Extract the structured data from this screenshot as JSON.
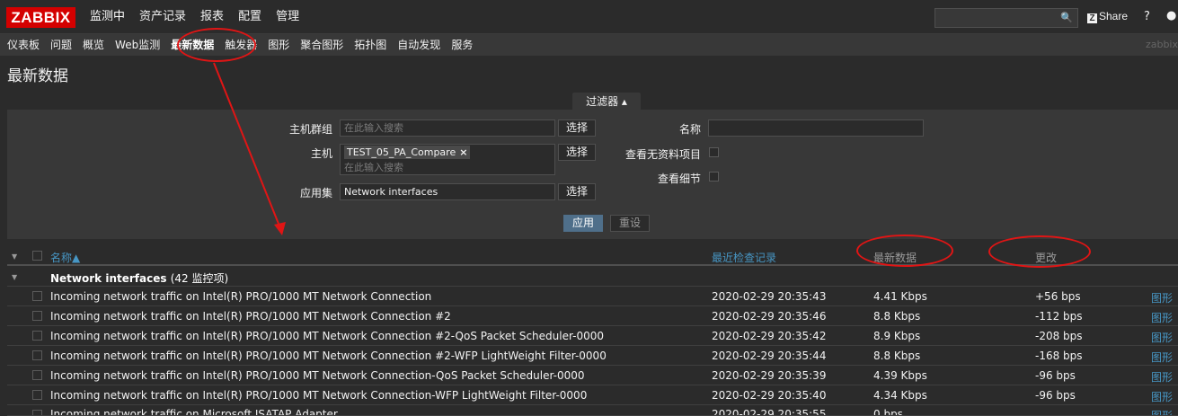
{
  "logo": "ZABBIX",
  "main_menu": [
    "监测中",
    "资产记录",
    "报表",
    "配置",
    "管理"
  ],
  "share": "Share",
  "share_badge": "Z",
  "help": "?",
  "sub_menu": [
    "仪表板",
    "问题",
    "概览",
    "Web监测",
    "最新数据",
    "触发器",
    "图形",
    "聚合图形",
    "拓扑图",
    "自动发现",
    "服务"
  ],
  "server_name": "zabbix",
  "page_title": "最新数据",
  "filter": {
    "tab_label": "过滤器 ▴",
    "host_group_label": "主机群组",
    "host_group_placeholder": "在此输入搜索",
    "host_label": "主机",
    "host_tag": "TEST_05_PA_Compare",
    "host_placeholder": "在此输入搜索",
    "app_label": "应用集",
    "app_value": "Network interfaces",
    "select_label": "选择",
    "name_label": "名称",
    "show_no_data_label": "查看无资料项目",
    "show_details_label": "查看细节",
    "apply_label": "应用",
    "reset_label": "重设"
  },
  "table": {
    "col_name": "名称▲",
    "col_lastcheck": "最近检查记录",
    "col_lastvalue": "最新数据",
    "col_change": "更改",
    "group_title": "Network interfaces",
    "group_count": "(42 监控项)",
    "graph_label": "图形",
    "rows": [
      {
        "name": "Incoming network traffic on Intel(R) PRO/1000 MT Network Connection",
        "time": "2020-02-29 20:35:43",
        "value": "4.41 Kbps",
        "change": "+56 bps"
      },
      {
        "name": "Incoming network traffic on Intel(R) PRO/1000 MT Network Connection #2",
        "time": "2020-02-29 20:35:46",
        "value": "8.8 Kbps",
        "change": "-112 bps"
      },
      {
        "name": "Incoming network traffic on Intel(R) PRO/1000 MT Network Connection #2-QoS Packet Scheduler-0000",
        "time": "2020-02-29 20:35:42",
        "value": "8.9 Kbps",
        "change": "-208 bps"
      },
      {
        "name": "Incoming network traffic on Intel(R) PRO/1000 MT Network Connection #2-WFP LightWeight Filter-0000",
        "time": "2020-02-29 20:35:44",
        "value": "8.8 Kbps",
        "change": "-168 bps"
      },
      {
        "name": "Incoming network traffic on Intel(R) PRO/1000 MT Network Connection-QoS Packet Scheduler-0000",
        "time": "2020-02-29 20:35:39",
        "value": "4.39 Kbps",
        "change": "-96 bps"
      },
      {
        "name": "Incoming network traffic on Intel(R) PRO/1000 MT Network Connection-WFP LightWeight Filter-0000",
        "time": "2020-02-29 20:35:40",
        "value": "4.34 Kbps",
        "change": "-96 bps"
      },
      {
        "name": "Incoming network traffic on Microsoft ISATAP Adapter",
        "time": "2020-02-29 20:35:55",
        "value": "0 bps",
        "change": ""
      }
    ]
  }
}
